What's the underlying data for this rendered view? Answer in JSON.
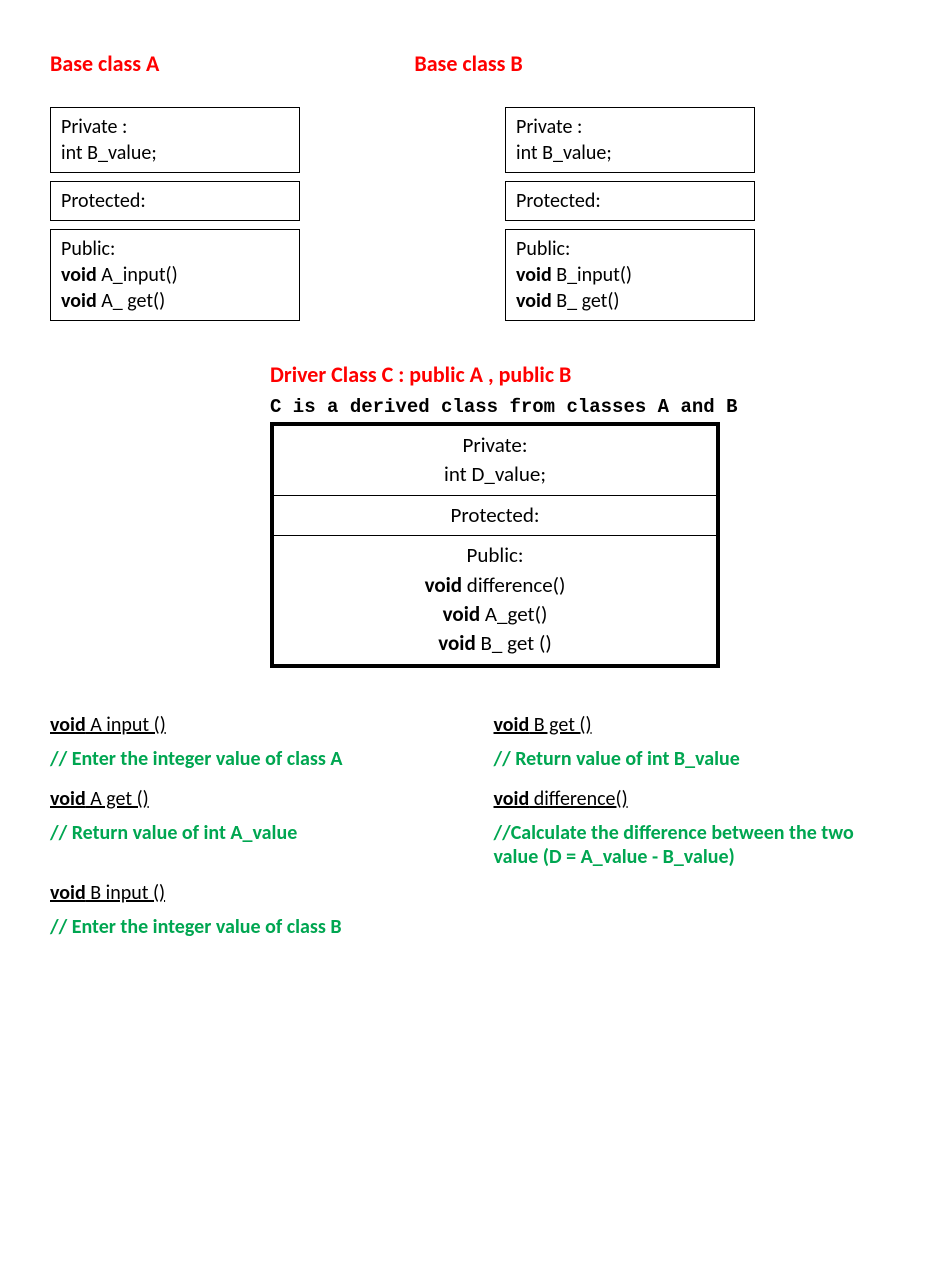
{
  "classA": {
    "title": "Base class A",
    "private_label": "Private :",
    "private_member": "int B_value;",
    "protected_label": "Protected:",
    "public_label": "Public:",
    "public_m1_kw": "void",
    "public_m1_name": " A_input()",
    "public_m2_kw": "void",
    "public_m2_name": " A_ get()"
  },
  "classB": {
    "title": "Base class B",
    "private_label": "Private :",
    "private_member": "int B_value;",
    "protected_label": "Protected:",
    "public_label": "Public:",
    "public_m1_kw": "void",
    "public_m1_name": " B_input()",
    "public_m2_kw": "void",
    "public_m2_name": " B_ get()"
  },
  "driver": {
    "title": "Driver  Class C : public A , public B",
    "subtitle": "C is a derived class from classes A and B",
    "private_label": "Private:",
    "private_member": "int D_value;",
    "protected_label": "Protected:",
    "public_label": "Public:",
    "m1_kw": "void",
    "m1_name": " difference()",
    "m2_kw": "void",
    "m2_name": " A_get()",
    "m3_kw": "void",
    "m3_name": " B_ get ()"
  },
  "methods": {
    "left": [
      {
        "kw": "void",
        "name": " A  input ()",
        "underline": true
      },
      {
        "comment": "// Enter the integer value of class A"
      },
      {
        "kw": "void",
        "name": " A   get ()",
        "underline": true
      },
      {
        "comment": "// Return value of int A_value"
      },
      {
        "spacer": true
      },
      {
        "kw": "void",
        "name": " B  input ()",
        "underline": true
      },
      {
        "comment": "// Enter the integer value of class B"
      }
    ],
    "right": [
      {
        "kw": "void",
        "name": " B   get ()",
        "underline": true
      },
      {
        "comment": "// Return value of int B_value"
      },
      {
        "kw": "void",
        "name": " difference()",
        "underline": true
      },
      {
        "comment": "//Calculate the difference between the two value   (D = A_value - B_value)"
      }
    ]
  }
}
